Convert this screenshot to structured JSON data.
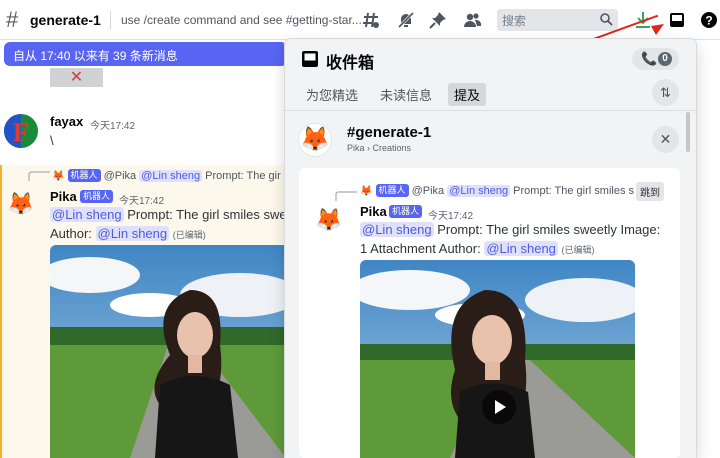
{
  "channel": {
    "hash": "#",
    "name": "generate-1",
    "topic": "use /create command and see #getting-star..."
  },
  "search": {
    "placeholder": "搜索"
  },
  "new_messages_bar": "自从 17:40 以来有 39 条新消息",
  "messages": {
    "fayax": {
      "name": "fayax",
      "time": "今天17:42",
      "text": "\\"
    },
    "pika": {
      "reply_badge": "机器人",
      "reply_user": "@Pika",
      "reply_mention": "@Lin sheng",
      "reply_text": "Prompt: The gir",
      "name": "Pika",
      "badge": "机器人",
      "time": "今天17:42",
      "mention": "@Lin sheng",
      "text": "Prompt: The girl smiles swe",
      "author_label": "Author:",
      "author_mention": "@Lin sheng",
      "edited": "(已编辑)"
    }
  },
  "inbox": {
    "title": "收件箱",
    "count": "0",
    "tabs": [
      "为您精选",
      "未读信息",
      "提及"
    ],
    "active_tab": "提及",
    "channel_name": "#generate-1",
    "breadcrumb": "Pika › Creations",
    "jump_label": "跳到",
    "message": {
      "reply_badge": "机器人",
      "reply_user": "@Pika",
      "reply_mention": "@Lin sheng",
      "reply_text": "Prompt: The girl smiles s",
      "name": "Pika",
      "badge": "机器人",
      "time": "今天17:42",
      "mention": "@Lin sheng",
      "text": "Prompt: The girl smiles sweetly  Image:",
      "line2": "1 Attachment  Author:",
      "author_mention": "@Lin sheng",
      "edited": "(已编辑)"
    }
  },
  "colors": {
    "accent": "#5865f2",
    "mention_bg": "#dee0fc",
    "arrow": "#e0261e",
    "download": "#3ba55c"
  }
}
